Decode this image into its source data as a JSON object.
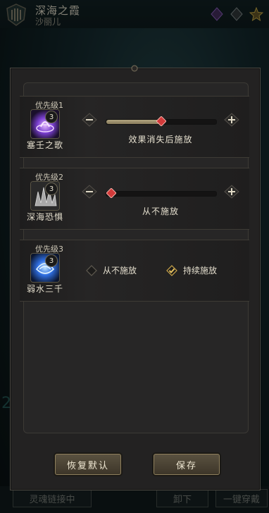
{
  "background": {
    "title": "深海之霞",
    "subtitle": "沙丽儿",
    "bottom_left_label": "灵魂链接中",
    "bottom_mid_label": "卸下",
    "bottom_right_label": "一键穿戴"
  },
  "dialog": {
    "skills": [
      {
        "priority_label": "优先级1",
        "name": "塞壬之歌",
        "level": "3",
        "control": "slider",
        "slider_level": 0.5,
        "status": "效果消失后施放",
        "icon": "siren-song-icon",
        "icon_color": "#7a3fd0"
      },
      {
        "priority_label": "优先级2",
        "name": "深海恐惧",
        "level": "3",
        "control": "slider",
        "slider_level": 0,
        "status": "从不施放",
        "icon": "deep-sea-fear-icon",
        "icon_color": "#9c9c9c"
      },
      {
        "priority_label": "优先级3",
        "name": "弱水三千",
        "level": "3",
        "control": "toggle",
        "icon": "weak-water-icon",
        "icon_color": "#2f6ee0",
        "options": [
          {
            "label": "从不施放",
            "checked": false
          },
          {
            "label": "持续施放",
            "checked": true
          }
        ]
      }
    ],
    "buttons": {
      "reset": "恢复默认",
      "save": "保存"
    }
  },
  "colors": {
    "accent_gold": "#c9a44a",
    "knob_red": "#d23a3a"
  }
}
